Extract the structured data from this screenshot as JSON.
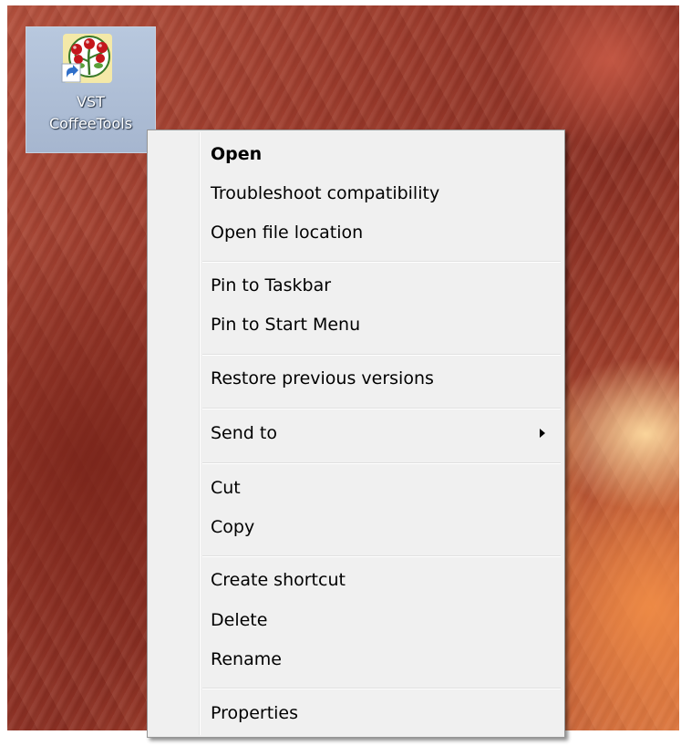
{
  "desktop": {
    "icon": {
      "caption_line1": "VST",
      "caption_line2": "CoffeeTools",
      "icon_name": "vst-coffeetools-shortcut-icon",
      "overlay_icon": "shortcut-arrow-icon",
      "selected": true
    }
  },
  "context_menu": {
    "items": {
      "open": {
        "label": "Open",
        "bold": true
      },
      "troubleshoot": {
        "label": "Troubleshoot compatibility"
      },
      "open_location": {
        "label": "Open file location"
      },
      "pin_taskbar": {
        "label": "Pin to Taskbar"
      },
      "pin_start": {
        "label": "Pin to Start Menu"
      },
      "restore": {
        "label": "Restore previous versions"
      },
      "send_to": {
        "label": "Send to",
        "has_submenu": true
      },
      "cut": {
        "label": "Cut"
      },
      "copy": {
        "label": "Copy"
      },
      "create_shortcut": {
        "label": "Create shortcut"
      },
      "delete": {
        "label": "Delete"
      },
      "rename": {
        "label": "Rename"
      },
      "properties": {
        "label": "Properties"
      }
    }
  },
  "colors": {
    "menu_background": "#f0f0f0",
    "menu_border": "#979797",
    "icon_selection": "#b8c8de",
    "wallpaper_red": "#9b3a2b",
    "wallpaper_orange": "#d7733f"
  }
}
